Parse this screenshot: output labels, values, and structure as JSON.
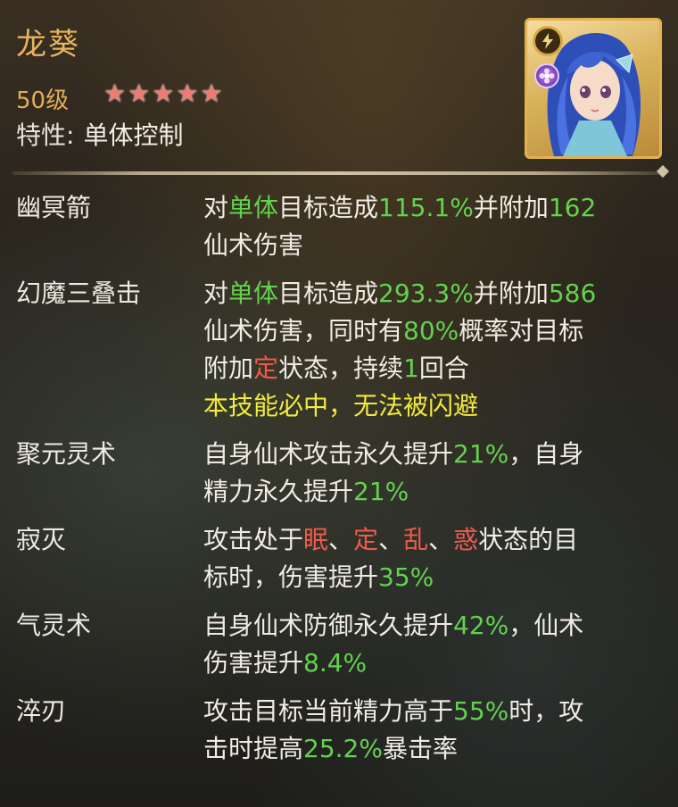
{
  "hero": {
    "name": "龙葵",
    "level": "50级",
    "star_count": 5,
    "trait_label": "特性:",
    "trait_value": "单体控制",
    "element_icon": "lightning-icon",
    "faction_icon": "flower-icon"
  },
  "colors": {
    "name": "#e8b45e",
    "highlight_green": "#63d24f",
    "highlight_red": "#ef5b4d",
    "highlight_yellow": "#f2ea3e",
    "stars": "#ee7b72",
    "portrait_frame": "#e3b24f"
  },
  "skills": [
    {
      "name": "幽冥箭",
      "lines": [
        [
          {
            "t": "对"
          },
          {
            "t": "单体",
            "c": "g"
          },
          {
            "t": "目标造成"
          },
          {
            "t": "115.1%",
            "c": "g"
          },
          {
            "t": "并附加"
          },
          {
            "t": "162",
            "c": "g"
          }
        ],
        [
          {
            "t": "仙术伤害"
          }
        ]
      ]
    },
    {
      "name": "幻魔三叠击",
      "lines": [
        [
          {
            "t": "对"
          },
          {
            "t": "单体",
            "c": "g"
          },
          {
            "t": "目标造成"
          },
          {
            "t": "293.3%",
            "c": "g"
          },
          {
            "t": "并附加"
          },
          {
            "t": "586",
            "c": "g"
          }
        ],
        [
          {
            "t": "仙术伤害，同时有"
          },
          {
            "t": "80%",
            "c": "g"
          },
          {
            "t": "概率对目标"
          }
        ],
        [
          {
            "t": "附加"
          },
          {
            "t": "定",
            "c": "r"
          },
          {
            "t": "状态，持续"
          },
          {
            "t": "1",
            "c": "g"
          },
          {
            "t": "回合"
          }
        ],
        [
          {
            "t": "本技能必中，无法被闪避",
            "c": "y"
          }
        ]
      ]
    },
    {
      "name": "聚元灵术",
      "lines": [
        [
          {
            "t": "自身仙术攻击永久提升"
          },
          {
            "t": "21%",
            "c": "g"
          },
          {
            "t": "，自身"
          }
        ],
        [
          {
            "t": "精力永久提升"
          },
          {
            "t": "21%",
            "c": "g"
          }
        ]
      ]
    },
    {
      "name": "寂灭",
      "lines": [
        [
          {
            "t": "攻击处于"
          },
          {
            "t": "眠",
            "c": "r"
          },
          {
            "t": "、"
          },
          {
            "t": "定",
            "c": "r"
          },
          {
            "t": "、"
          },
          {
            "t": "乱",
            "c": "r"
          },
          {
            "t": "、"
          },
          {
            "t": "惑",
            "c": "r"
          },
          {
            "t": "状态的目"
          }
        ],
        [
          {
            "t": "标时，伤害提升"
          },
          {
            "t": "35%",
            "c": "g"
          }
        ]
      ]
    },
    {
      "name": "气灵术",
      "lines": [
        [
          {
            "t": "自身仙术防御永久提升"
          },
          {
            "t": "42%",
            "c": "g"
          },
          {
            "t": "，仙术"
          }
        ],
        [
          {
            "t": "伤害提升"
          },
          {
            "t": "8.4%",
            "c": "g"
          }
        ]
      ]
    },
    {
      "name": "淬刃",
      "lines": [
        [
          {
            "t": "攻击目标当前精力高于"
          },
          {
            "t": "55%",
            "c": "g"
          },
          {
            "t": "时，攻"
          }
        ],
        [
          {
            "t": "击时提高"
          },
          {
            "t": "25.2%",
            "c": "g"
          },
          {
            "t": "暴击率"
          }
        ]
      ]
    }
  ]
}
